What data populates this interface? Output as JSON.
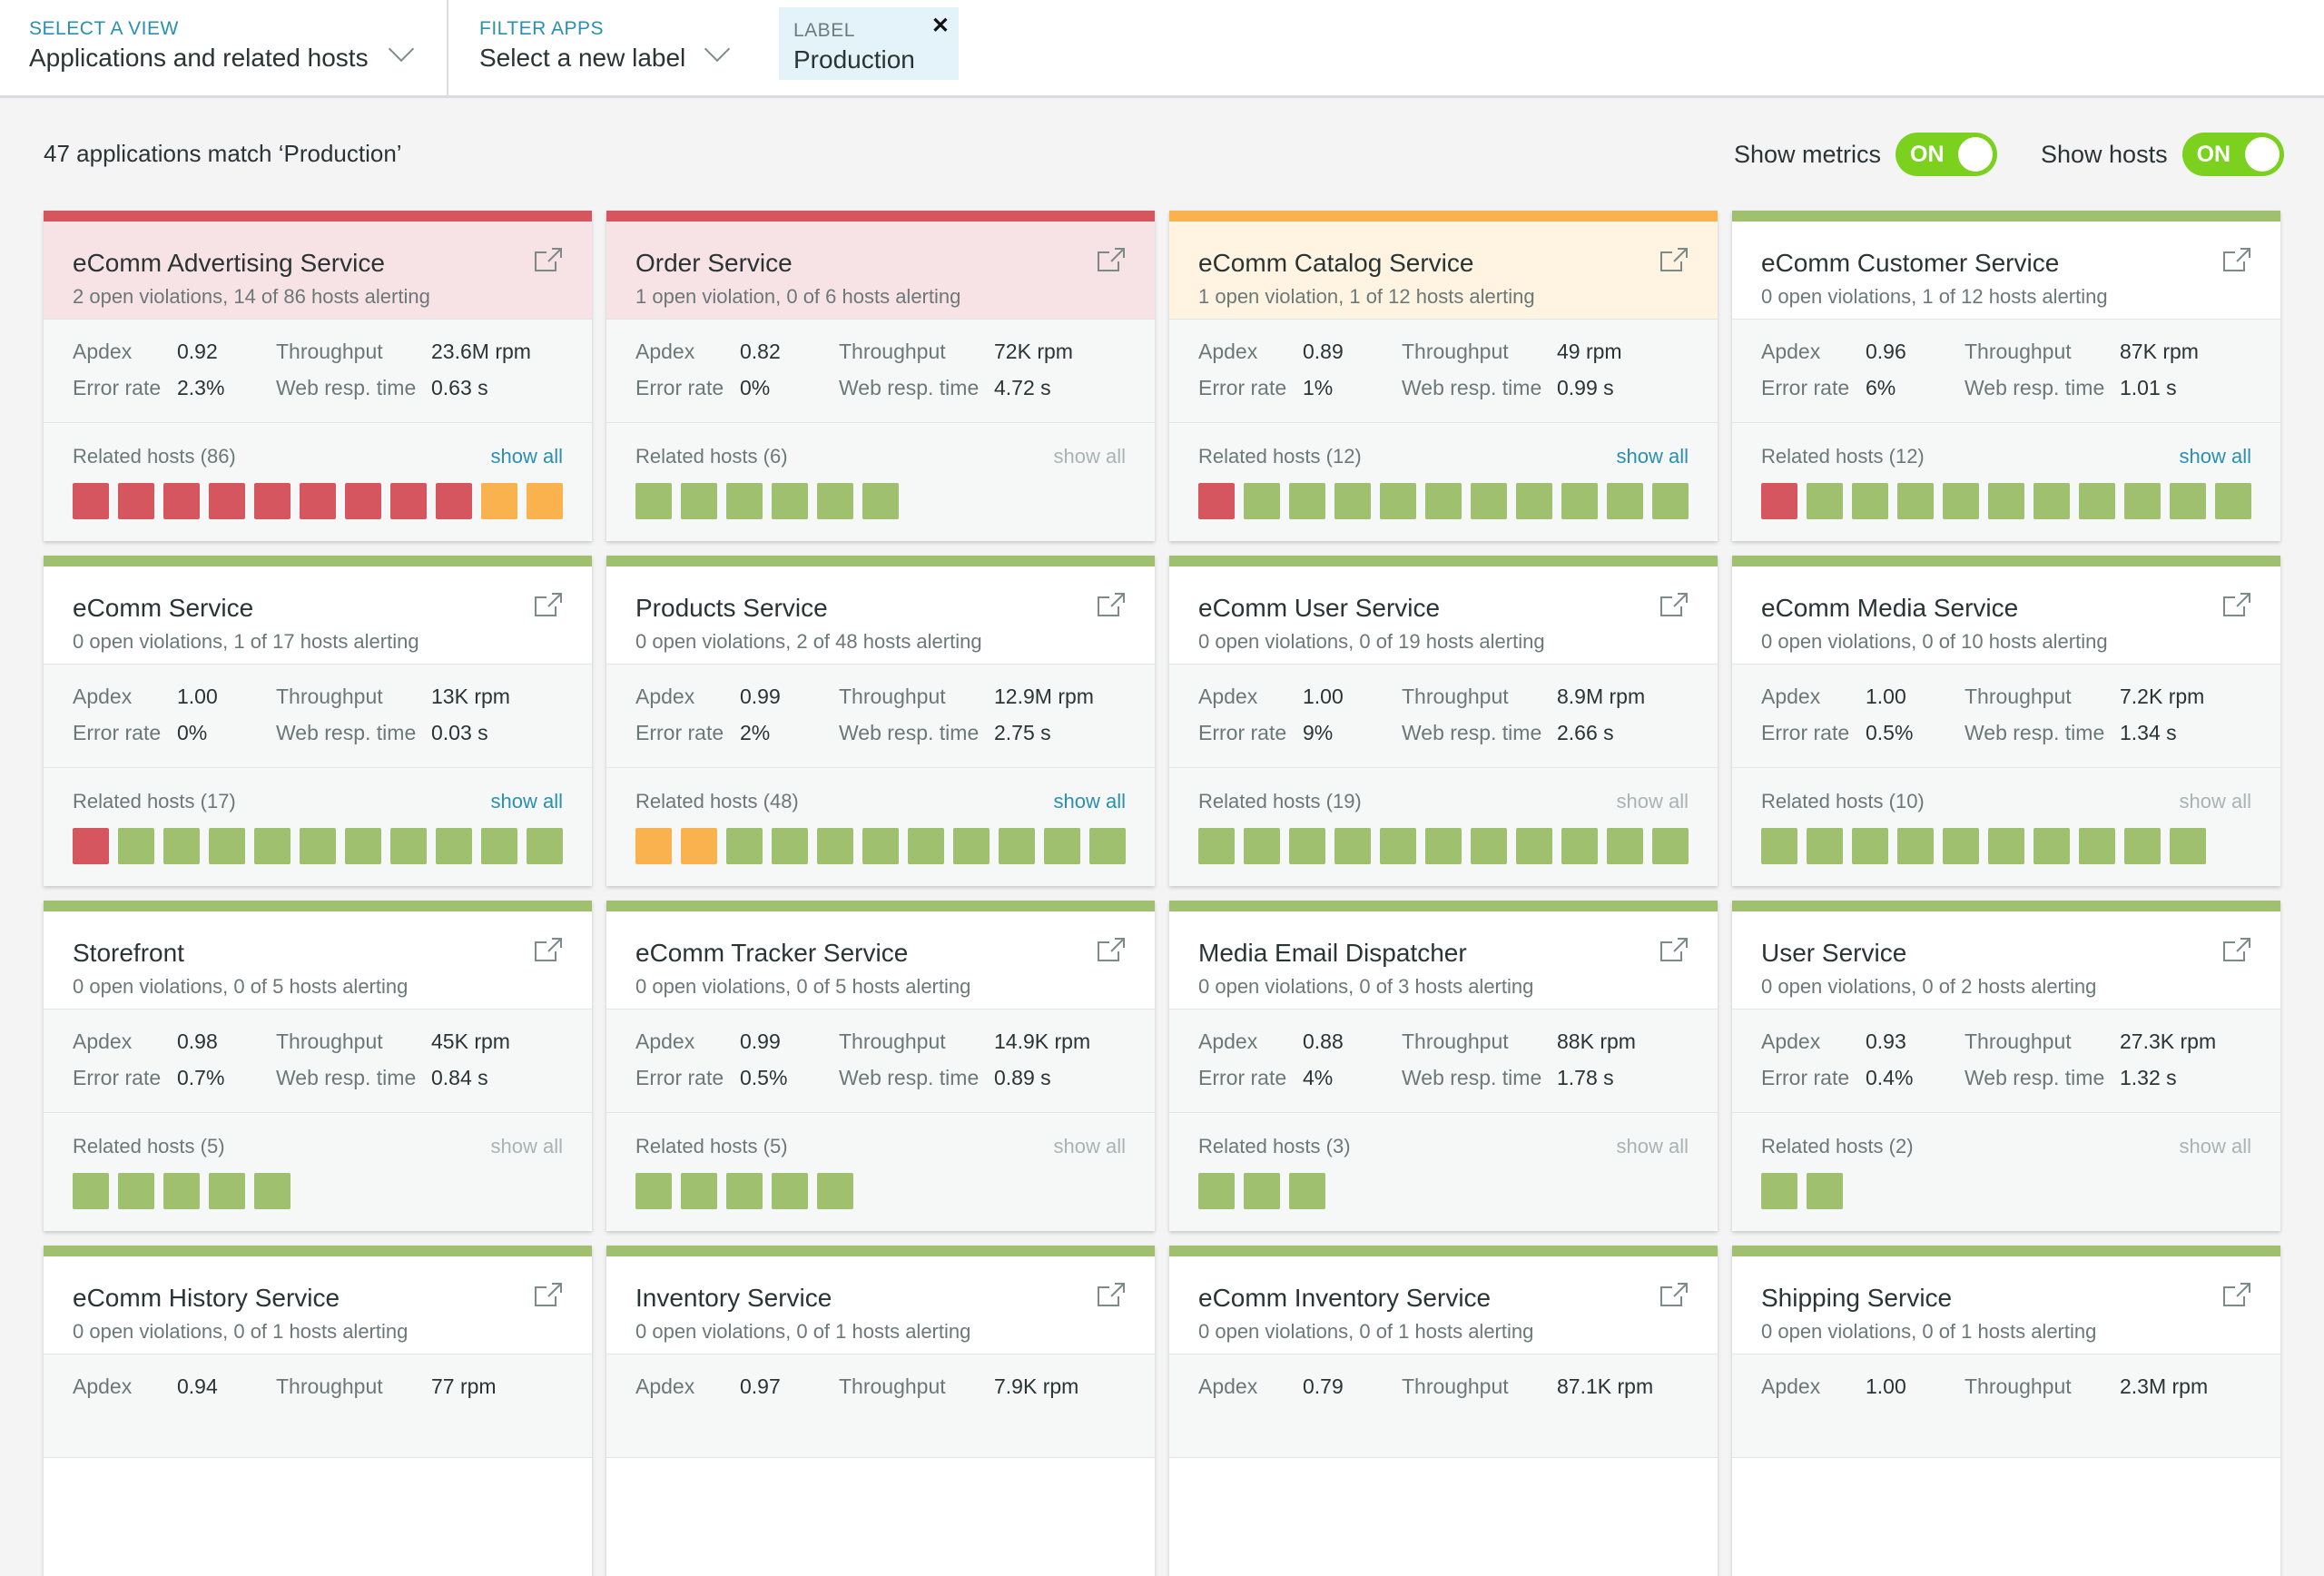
{
  "header": {
    "view": {
      "label": "SELECT A VIEW",
      "value": "Applications and related hosts"
    },
    "filter": {
      "label": "FILTER APPS",
      "value": "Select a new label"
    },
    "label_chip": {
      "label": "LABEL",
      "value": "Production",
      "close": "✕"
    }
  },
  "summary": {
    "match_text": "47 applications match ‘Production’",
    "show_metrics_label": "Show metrics",
    "show_metrics_state": "ON",
    "show_hosts_label": "Show hosts",
    "show_hosts_state": "ON"
  },
  "metric_labels": {
    "apdex": "Apdex",
    "error_rate": "Error rate",
    "throughput": "Throughput",
    "web_resp": "Web resp. time"
  },
  "show_all_label": "show all",
  "colors": {
    "healthy": "#9fc06f",
    "critical": "#d5565f",
    "warning": "#f9b24e",
    "toggle_on": "#7bd11e",
    "link": "#2b8fb0"
  },
  "apps": [
    {
      "name": "eComm Advertising Service",
      "status": "critical",
      "violations": "2 open violations, 14 of 86 hosts alerting",
      "apdex": "0.92",
      "error_rate": "2.3%",
      "throughput": "23.6M rpm",
      "web_resp": "0.63 s",
      "hosts_title": "Related hosts (86)",
      "show_all_active": true,
      "hosts": [
        "critical",
        "critical",
        "critical",
        "critical",
        "critical",
        "critical",
        "critical",
        "critical",
        "critical",
        "warning",
        "warning"
      ]
    },
    {
      "name": "Order Service",
      "status": "critical",
      "violations": "1 open violation, 0 of 6 hosts alerting",
      "apdex": "0.82",
      "error_rate": "0%",
      "throughput": "72K rpm",
      "web_resp": "4.72 s",
      "hosts_title": "Related hosts (6)",
      "show_all_active": false,
      "hosts": [
        "ok",
        "ok",
        "ok",
        "ok",
        "ok",
        "ok"
      ]
    },
    {
      "name": "eComm Catalog Service",
      "status": "warning",
      "violations": "1 open violation, 1 of 12 hosts alerting",
      "apdex": "0.89",
      "error_rate": "1%",
      "throughput": "49 rpm",
      "web_resp": "0.99 s",
      "hosts_title": "Related hosts (12)",
      "show_all_active": true,
      "hosts": [
        "critical",
        "ok",
        "ok",
        "ok",
        "ok",
        "ok",
        "ok",
        "ok",
        "ok",
        "ok",
        "ok"
      ]
    },
    {
      "name": "eComm Customer Service",
      "status": "ok",
      "violations": "0 open violations, 1 of 12 hosts alerting",
      "apdex": "0.96",
      "error_rate": "6%",
      "throughput": "87K rpm",
      "web_resp": "1.01 s",
      "hosts_title": "Related hosts (12)",
      "show_all_active": true,
      "hosts": [
        "critical",
        "ok",
        "ok",
        "ok",
        "ok",
        "ok",
        "ok",
        "ok",
        "ok",
        "ok",
        "ok"
      ]
    },
    {
      "name": "eComm Service",
      "status": "ok",
      "violations": "0 open violations, 1 of 17 hosts alerting",
      "apdex": "1.00",
      "error_rate": "0%",
      "throughput": "13K rpm",
      "web_resp": "0.03 s",
      "hosts_title": "Related hosts (17)",
      "show_all_active": true,
      "hosts": [
        "critical",
        "ok",
        "ok",
        "ok",
        "ok",
        "ok",
        "ok",
        "ok",
        "ok",
        "ok",
        "ok"
      ]
    },
    {
      "name": "Products Service",
      "status": "ok",
      "violations": "0 open violations, 2 of 48 hosts alerting",
      "apdex": "0.99",
      "error_rate": "2%",
      "throughput": "12.9M rpm",
      "web_resp": "2.75 s",
      "hosts_title": "Related hosts (48)",
      "show_all_active": true,
      "hosts": [
        "warning",
        "warning",
        "ok",
        "ok",
        "ok",
        "ok",
        "ok",
        "ok",
        "ok",
        "ok",
        "ok"
      ]
    },
    {
      "name": "eComm User Service",
      "status": "ok",
      "violations": "0 open violations, 0 of 19 hosts alerting",
      "apdex": "1.00",
      "error_rate": "9%",
      "throughput": "8.9M rpm",
      "web_resp": "2.66 s",
      "hosts_title": "Related hosts (19)",
      "show_all_active": false,
      "hosts": [
        "ok",
        "ok",
        "ok",
        "ok",
        "ok",
        "ok",
        "ok",
        "ok",
        "ok",
        "ok",
        "ok"
      ]
    },
    {
      "name": "eComm Media Service",
      "status": "ok",
      "violations": "0 open violations, 0 of 10 hosts alerting",
      "apdex": "1.00",
      "error_rate": "0.5%",
      "throughput": "7.2K rpm",
      "web_resp": "1.34 s",
      "hosts_title": "Related hosts (10)",
      "show_all_active": false,
      "hosts": [
        "ok",
        "ok",
        "ok",
        "ok",
        "ok",
        "ok",
        "ok",
        "ok",
        "ok",
        "ok"
      ]
    },
    {
      "name": "Storefront",
      "status": "ok",
      "violations": "0 open violations, 0 of 5 hosts alerting",
      "apdex": "0.98",
      "error_rate": "0.7%",
      "throughput": "45K rpm",
      "web_resp": "0.84 s",
      "hosts_title": "Related hosts (5)",
      "show_all_active": false,
      "hosts": [
        "ok",
        "ok",
        "ok",
        "ok",
        "ok"
      ]
    },
    {
      "name": "eComm Tracker Service",
      "status": "ok",
      "violations": "0 open violations, 0 of 5 hosts alerting",
      "apdex": "0.99",
      "error_rate": "0.5%",
      "throughput": "14.9K rpm",
      "web_resp": "0.89 s",
      "hosts_title": "Related hosts (5)",
      "show_all_active": false,
      "hosts": [
        "ok",
        "ok",
        "ok",
        "ok",
        "ok"
      ]
    },
    {
      "name": "Media Email Dispatcher",
      "status": "ok",
      "violations": "0 open violations, 0 of 3 hosts alerting",
      "apdex": "0.88",
      "error_rate": "4%",
      "throughput": "88K rpm",
      "web_resp": "1.78 s",
      "hosts_title": "Related hosts (3)",
      "show_all_active": false,
      "hosts": [
        "ok",
        "ok",
        "ok"
      ]
    },
    {
      "name": "User Service",
      "status": "ok",
      "violations": "0 open violations, 0 of 2 hosts alerting",
      "apdex": "0.93",
      "error_rate": "0.4%",
      "throughput": "27.3K rpm",
      "web_resp": "1.32 s",
      "hosts_title": "Related hosts (2)",
      "show_all_active": false,
      "hosts": [
        "ok",
        "ok"
      ]
    },
    {
      "name": "eComm History Service",
      "status": "ok",
      "violations": "0 open violations, 0 of 1 hosts alerting",
      "apdex": "0.94",
      "throughput": "77 rpm"
    },
    {
      "name": "Inventory Service",
      "status": "ok",
      "violations": "0 open violations, 0 of 1 hosts alerting",
      "apdex": "0.97",
      "throughput": "7.9K rpm"
    },
    {
      "name": "eComm Inventory Service",
      "status": "ok",
      "violations": "0 open violations, 0 of 1 hosts alerting",
      "apdex": "0.79",
      "throughput": "87.1K rpm"
    },
    {
      "name": "Shipping Service",
      "status": "ok",
      "violations": "0 open violations, 0 of 1 hosts alerting",
      "apdex": "1.00",
      "throughput": "2.3M rpm"
    }
  ]
}
